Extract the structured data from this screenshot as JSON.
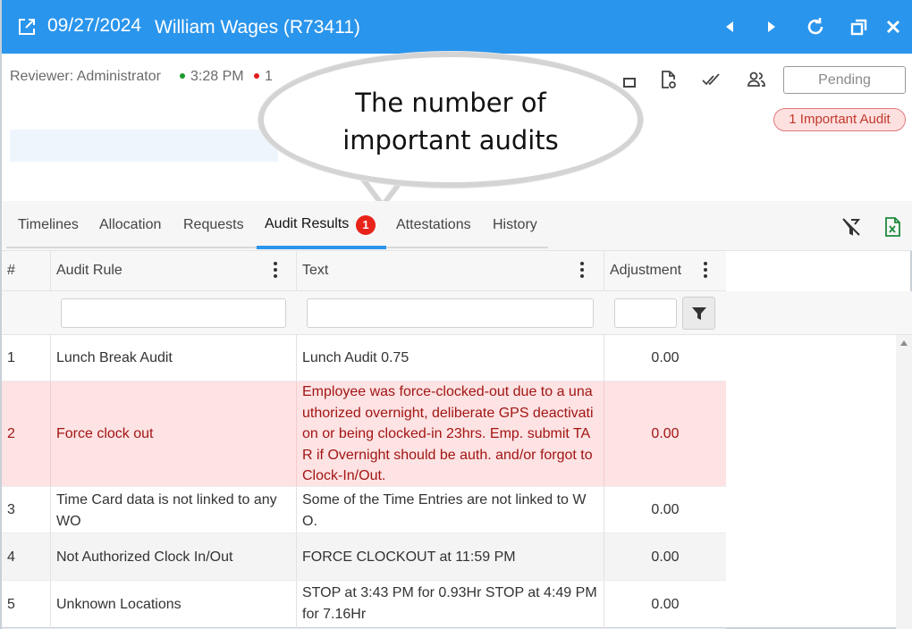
{
  "window": {
    "date": "09/27/2024",
    "employee": "William Wages (R73411)",
    "controls": [
      "prev-icon",
      "next-icon",
      "refresh-icon",
      "restore-icon",
      "close-icon"
    ]
  },
  "info": {
    "reviewer": "Reviewer: Administrator",
    "time_in": "3:28 PM",
    "time_out_partial": "1",
    "status_button": "Pending",
    "important_badge": "1 Important Audit",
    "colors": {
      "in_dot": "#1a9a2a",
      "out_dot": "#e21b1b",
      "accent": "#2a95ec"
    }
  },
  "callout": {
    "line1": "The number of",
    "line2": "important audits"
  },
  "tabs": [
    {
      "label": "Timelines"
    },
    {
      "label": "Allocation"
    },
    {
      "label": "Requests"
    },
    {
      "label": "Audit Results",
      "badge": "1",
      "active": true
    },
    {
      "label": "Attestations"
    },
    {
      "label": "History"
    }
  ],
  "grid": {
    "headers": {
      "num": "#",
      "rule": "Audit Rule",
      "text": "Text",
      "adj": "Adjustment"
    },
    "rows": [
      {
        "num": "1",
        "rule": "Lunch Break Audit",
        "text": "Lunch Audit 0.75",
        "adj": "0.00"
      },
      {
        "num": "2",
        "rule": "Force clock out",
        "text": "Employee was force-clocked-out due to a unauthorized overnight, deliberate GPS deactivation or being clocked-in 23hrs. Emp. submit TAR if Overnight should be auth. and/or forgot to Clock-In/Out.",
        "adj": "0.00",
        "important": true
      },
      {
        "num": "3",
        "rule": "Time Card data is not linked to any WO",
        "text": "Some of the Time Entries are not linked to WO.",
        "adj": "0.00"
      },
      {
        "num": "4",
        "rule": "Not Authorized Clock In/Out",
        "text": "FORCE CLOCKOUT at 11:59 PM",
        "adj": "0.00"
      },
      {
        "num": "5",
        "rule": "Unknown Locations",
        "text": "STOP at 3:43 PM for 0.93Hr STOP at 4:49 PM for 7.16Hr",
        "adj": "0.00"
      }
    ]
  }
}
